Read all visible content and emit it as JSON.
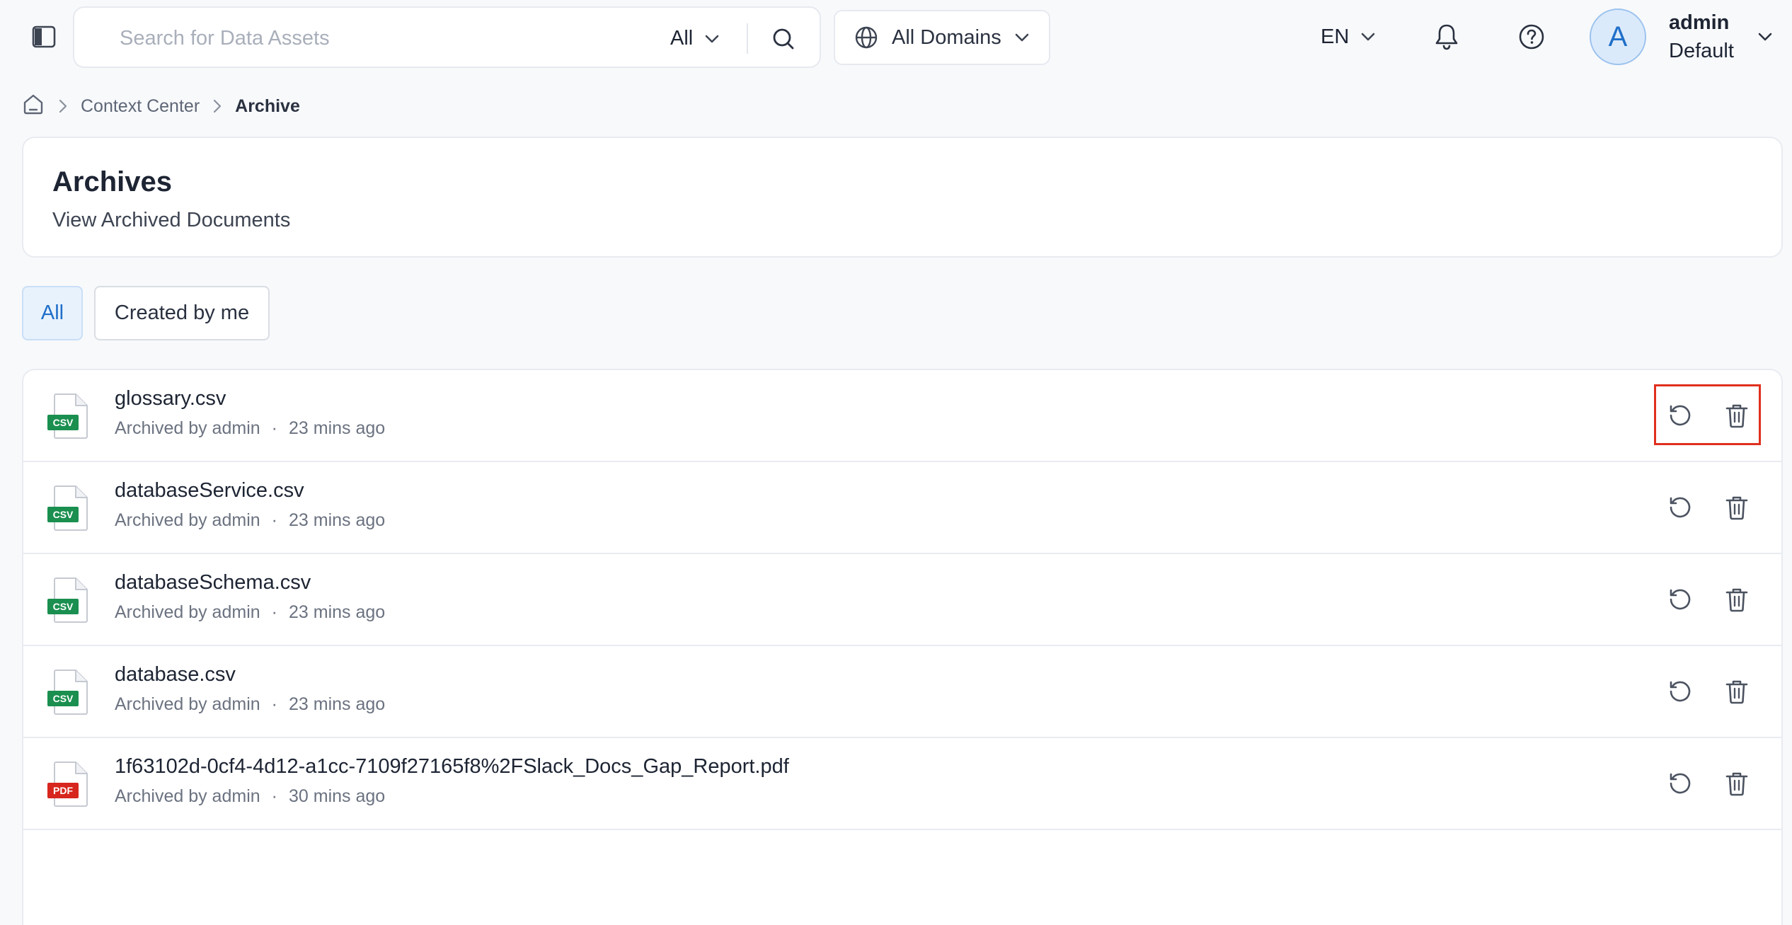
{
  "topbar": {
    "search": {
      "placeholder": "Search for Data Assets",
      "type_label": "All"
    },
    "domains_label": "All Domains",
    "language": "EN",
    "user": {
      "avatar_letter": "A",
      "name": "admin",
      "role": "Default"
    }
  },
  "breadcrumb": {
    "items": [
      "Context Center",
      "Archive"
    ]
  },
  "header": {
    "title": "Archives",
    "subtitle": "View Archived Documents"
  },
  "filters": {
    "all_label": "All",
    "mine_label": "Created by me",
    "selected": "All"
  },
  "files": [
    {
      "icon": "csv-file-icon",
      "badge": "CSV",
      "name": "glossary.csv",
      "archived_by": "Archived by admin",
      "dot": "·",
      "time": "23 mins ago"
    },
    {
      "icon": "csv-file-icon",
      "badge": "CSV",
      "name": "databaseService.csv",
      "archived_by": "Archived by admin",
      "dot": "·",
      "time": "23 mins ago"
    },
    {
      "icon": "csv-file-icon",
      "badge": "CSV",
      "name": "databaseSchema.csv",
      "archived_by": "Archived by admin",
      "dot": "·",
      "time": "23 mins ago"
    },
    {
      "icon": "csv-file-icon",
      "badge": "CSV",
      "name": "database.csv",
      "archived_by": "Archived by admin",
      "dot": "·",
      "time": "23 mins ago"
    },
    {
      "icon": "pdf-file-icon",
      "badge": "PDF",
      "name": "1f63102d-0cf4-4d12-a1cc-7109f27165f8%2FSlack_Docs_Gap_Report.pdf",
      "archived_by": "Archived by admin",
      "dot": "·",
      "time": "30 mins ago"
    }
  ],
  "colors": {
    "csv_badge": "#1a8f4f",
    "pdf_badge": "#d7261e",
    "accent": "#1f6fc9",
    "highlight": "#e0301e"
  }
}
